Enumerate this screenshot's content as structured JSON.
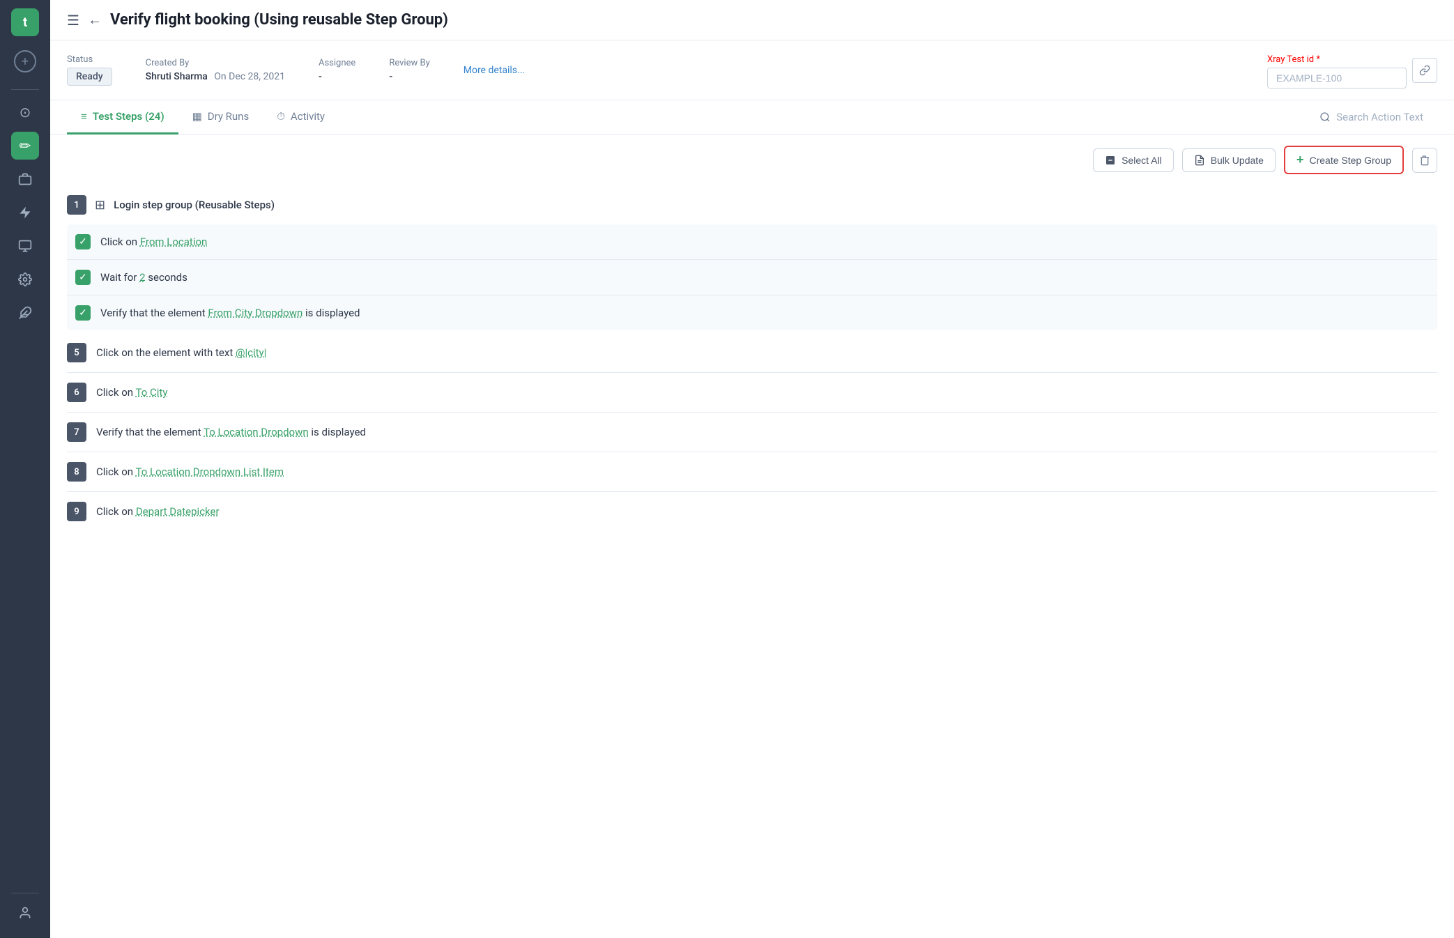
{
  "app": {
    "logo_text": "t",
    "title": "Verify flight booking (Using reusable Step Group)"
  },
  "sidebar": {
    "icons": [
      {
        "name": "dashboard-icon",
        "symbol": "⊙",
        "active": false
      },
      {
        "name": "edit-icon",
        "symbol": "✏",
        "active": true
      },
      {
        "name": "briefcase-icon",
        "symbol": "💼",
        "active": false
      },
      {
        "name": "lightning-icon",
        "symbol": "⚡",
        "active": false
      },
      {
        "name": "monitor-icon",
        "symbol": "🖥",
        "active": false
      },
      {
        "name": "settings-gear-icon",
        "symbol": "⚙",
        "active": false
      },
      {
        "name": "puzzle-icon",
        "symbol": "🧩",
        "active": false
      },
      {
        "name": "person-icon",
        "symbol": "👤",
        "active": false
      }
    ]
  },
  "meta": {
    "status_label": "Status",
    "status_value": "Ready",
    "created_by_label": "Created By",
    "created_by_name": "Shruti Sharma",
    "created_by_date": "On Dec 28, 2021",
    "assignee_label": "Assignee",
    "assignee_value": "-",
    "review_by_label": "Review By",
    "review_by_value": "-",
    "more_details_label": "More details...",
    "xray_label": "Xray Test id",
    "xray_required": "*",
    "xray_placeholder": "EXAMPLE-100"
  },
  "tabs": [
    {
      "label": "Test Steps (24)",
      "icon": "≡",
      "active": true,
      "name": "test-steps-tab"
    },
    {
      "label": "Dry Runs",
      "icon": "▦",
      "active": false,
      "name": "dry-runs-tab"
    },
    {
      "label": "Activity",
      "icon": "⏱",
      "active": false,
      "name": "activity-tab"
    }
  ],
  "search": {
    "placeholder": "Search Action Text"
  },
  "toolbar": {
    "select_all_label": "Select All",
    "bulk_update_label": "Bulk Update",
    "create_group_label": "Create Step Group",
    "delete_label": "Delete"
  },
  "steps": [
    {
      "type": "group_header",
      "number": "1",
      "label": "Login step group (Reusable Steps)"
    },
    {
      "type": "checked",
      "text_before": "Click on",
      "link": "From Location",
      "text_after": ""
    },
    {
      "type": "checked",
      "text_before": "Wait for",
      "link": "2",
      "text_after": "seconds"
    },
    {
      "type": "checked",
      "text_before": "Verify that the element",
      "link": "From City Dropdown",
      "text_after": "is displayed"
    },
    {
      "type": "plain",
      "number": "5",
      "text_before": "Click on the element with text",
      "link": "@|city|",
      "text_after": ""
    },
    {
      "type": "plain",
      "number": "6",
      "text_before": "Click on",
      "link": "To City",
      "text_after": ""
    },
    {
      "type": "plain",
      "number": "7",
      "text_before": "Verify that the element",
      "link": "To Location Dropdown",
      "text_after": "is displayed"
    },
    {
      "type": "plain",
      "number": "8",
      "text_before": "Click on",
      "link": "To Location Dropdown List Item",
      "text_after": ""
    },
    {
      "type": "plain",
      "number": "9",
      "text_before": "Click on",
      "link": "Depart Datepicker",
      "text_after": ""
    }
  ]
}
